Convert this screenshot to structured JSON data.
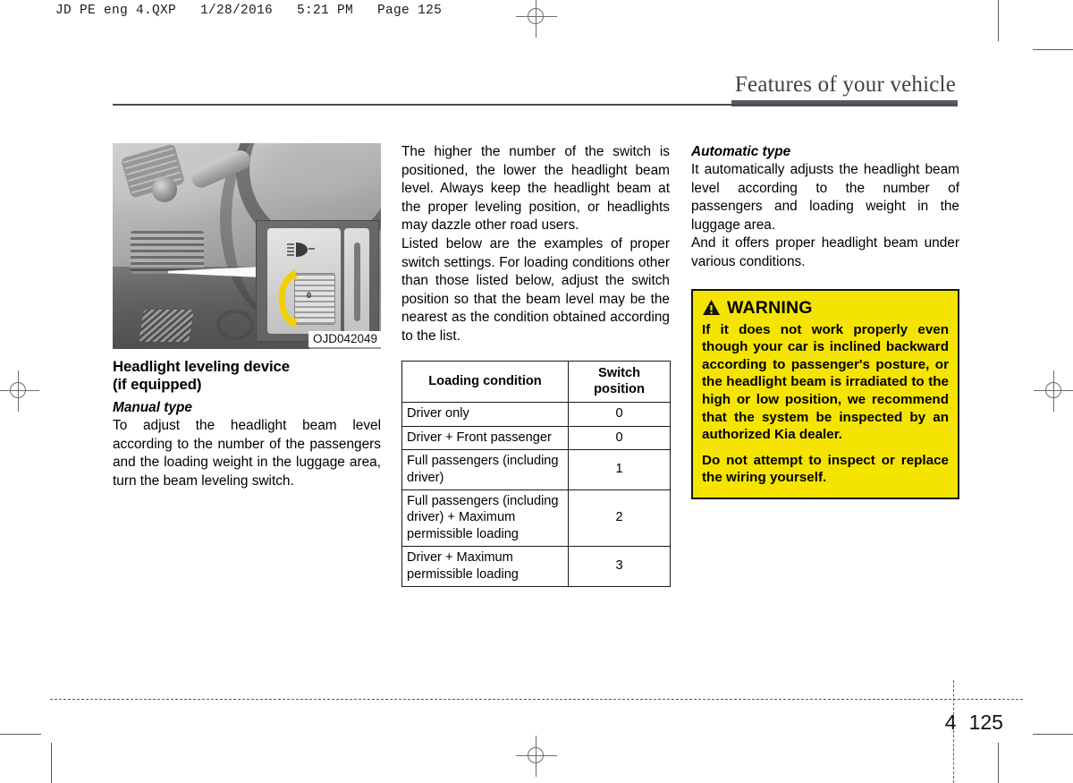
{
  "prepress": {
    "slug": "JD PE eng 4.QXP   1/28/2016   5:21 PM   Page 125"
  },
  "running_head": {
    "title": "Features of your vehicle"
  },
  "figure": {
    "caption": "OJD042049",
    "alt_name": "headlight-leveling-switch-photo"
  },
  "left_column": {
    "heading_line1": "Headlight leveling device",
    "heading_line2": "(if equipped)",
    "subhead": "Manual type",
    "paragraph": "To adjust the headlight beam level according to the number of the passengers and the loading weight in the luggage area, turn the beam leveling switch."
  },
  "middle_column": {
    "paragraph1": "The higher the number of the switch is positioned, the lower the headlight beam level. Always keep the headlight beam at the proper leveling position, or headlights may dazzle other road users.",
    "paragraph2": "Listed below are the examples of proper switch settings. For loading conditions other than those listed below, adjust the switch position so that the beam level may be the nearest as the condition obtained according to the list.",
    "table": {
      "headers": [
        "Loading condition",
        "Switch position"
      ],
      "rows": [
        {
          "condition": "Driver only",
          "position": "0"
        },
        {
          "condition": "Driver + Front passenger",
          "position": "0"
        },
        {
          "condition": "Full passengers (including driver)",
          "position": "1"
        },
        {
          "condition": "Full passengers (including driver) + Maximum permissible loading",
          "position": "2"
        },
        {
          "condition": "Driver + Maximum permissible loading",
          "position": "3"
        }
      ]
    }
  },
  "right_column": {
    "subhead": "Automatic type",
    "paragraph1": "It automatically adjusts the headlight beam level according to the number of passengers and loading weight in the luggage area.",
    "paragraph2": "And it offers proper headlight beam under various conditions.",
    "warning": {
      "label": "WARNING",
      "paragraph1": "If it does not work properly even though your car is inclined backward according to passenger's posture, or the headlight beam is irradiated to the high or low position, we recommend that the system be inspected by an authorized Kia dealer.",
      "paragraph2": "Do not attempt to inspect or replace the wiring yourself.",
      "background_color": "#F5E400",
      "border_color": "#111111"
    }
  },
  "folio": {
    "chapter": "4",
    "page": "125"
  }
}
